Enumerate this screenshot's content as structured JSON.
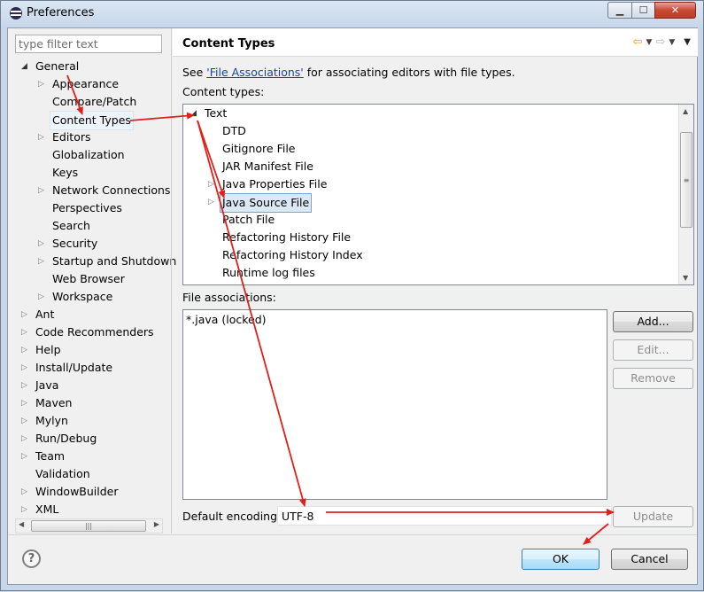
{
  "window": {
    "title": "Preferences"
  },
  "controls": {
    "minimize": "▁",
    "maximize": "☐",
    "close": "✕"
  },
  "left": {
    "filter_placeholder": "type filter text",
    "tree": [
      {
        "label": "General",
        "level": 0,
        "twisty": "open"
      },
      {
        "label": "Appearance",
        "level": 1,
        "twisty": "closed"
      },
      {
        "label": "Compare/Patch",
        "level": 1,
        "twisty": "none"
      },
      {
        "label": "Content Types",
        "level": 1,
        "twisty": "none",
        "selected": true
      },
      {
        "label": "Editors",
        "level": 1,
        "twisty": "closed"
      },
      {
        "label": "Globalization",
        "level": 1,
        "twisty": "none"
      },
      {
        "label": "Keys",
        "level": 1,
        "twisty": "none"
      },
      {
        "label": "Network Connections",
        "level": 1,
        "twisty": "closed"
      },
      {
        "label": "Perspectives",
        "level": 1,
        "twisty": "none"
      },
      {
        "label": "Search",
        "level": 1,
        "twisty": "none"
      },
      {
        "label": "Security",
        "level": 1,
        "twisty": "closed"
      },
      {
        "label": "Startup and Shutdown",
        "level": 1,
        "twisty": "closed"
      },
      {
        "label": "Web Browser",
        "level": 1,
        "twisty": "none"
      },
      {
        "label": "Workspace",
        "level": 1,
        "twisty": "closed"
      },
      {
        "label": "Ant",
        "level": 0,
        "twisty": "closed"
      },
      {
        "label": "Code Recommenders",
        "level": 0,
        "twisty": "closed"
      },
      {
        "label": "Help",
        "level": 0,
        "twisty": "closed"
      },
      {
        "label": "Install/Update",
        "level": 0,
        "twisty": "closed"
      },
      {
        "label": "Java",
        "level": 0,
        "twisty": "closed"
      },
      {
        "label": "Maven",
        "level": 0,
        "twisty": "closed"
      },
      {
        "label": "Mylyn",
        "level": 0,
        "twisty": "closed"
      },
      {
        "label": "Run/Debug",
        "level": 0,
        "twisty": "closed"
      },
      {
        "label": "Team",
        "level": 0,
        "twisty": "closed"
      },
      {
        "label": "Validation",
        "level": 0,
        "twisty": "none"
      },
      {
        "label": "WindowBuilder",
        "level": 0,
        "twisty": "closed"
      },
      {
        "label": "XML",
        "level": 0,
        "twisty": "closed"
      }
    ]
  },
  "page": {
    "title": "Content Types",
    "see_prefix": "See ",
    "see_link": "'File Associations'",
    "see_suffix": " for associating editors with file types.",
    "content_types_label": "Content types:",
    "content_types": [
      {
        "label": "Text",
        "level": 0,
        "twisty": "open"
      },
      {
        "label": "DTD",
        "level": 1,
        "twisty": "none"
      },
      {
        "label": "Gitignore File",
        "level": 1,
        "twisty": "none"
      },
      {
        "label": "JAR Manifest File",
        "level": 1,
        "twisty": "none"
      },
      {
        "label": "Java Properties File",
        "level": 1,
        "twisty": "closed"
      },
      {
        "label": "Java Source File",
        "level": 1,
        "twisty": "closed",
        "selected": true
      },
      {
        "label": "Patch File",
        "level": 1,
        "twisty": "none"
      },
      {
        "label": "Refactoring History File",
        "level": 1,
        "twisty": "none"
      },
      {
        "label": "Refactoring History Index",
        "level": 1,
        "twisty": "none"
      },
      {
        "label": "Runtime log files",
        "level": 1,
        "twisty": "none"
      }
    ],
    "file_associations_label": "File associations:",
    "file_associations": [
      "*.java (locked)"
    ],
    "add_button": "Add...",
    "edit_button": "Edit...",
    "remove_button": "Remove",
    "default_encoding_label": "Default encoding:",
    "default_encoding_value": "UTF-8",
    "update_button": "Update"
  },
  "footer": {
    "help": "?",
    "ok_button": "OK",
    "cancel_button": "Cancel"
  },
  "scroll_glyphs": {
    "up": "▲",
    "down": "▼",
    "left": "◀",
    "right": "▶",
    "grip_h": "|||",
    "grip_v": "≡"
  },
  "nav": {
    "back": "⇦",
    "forward": "⇨",
    "dropdown": "▼",
    "menu": "▼"
  },
  "annotation_color": "#e0201b"
}
